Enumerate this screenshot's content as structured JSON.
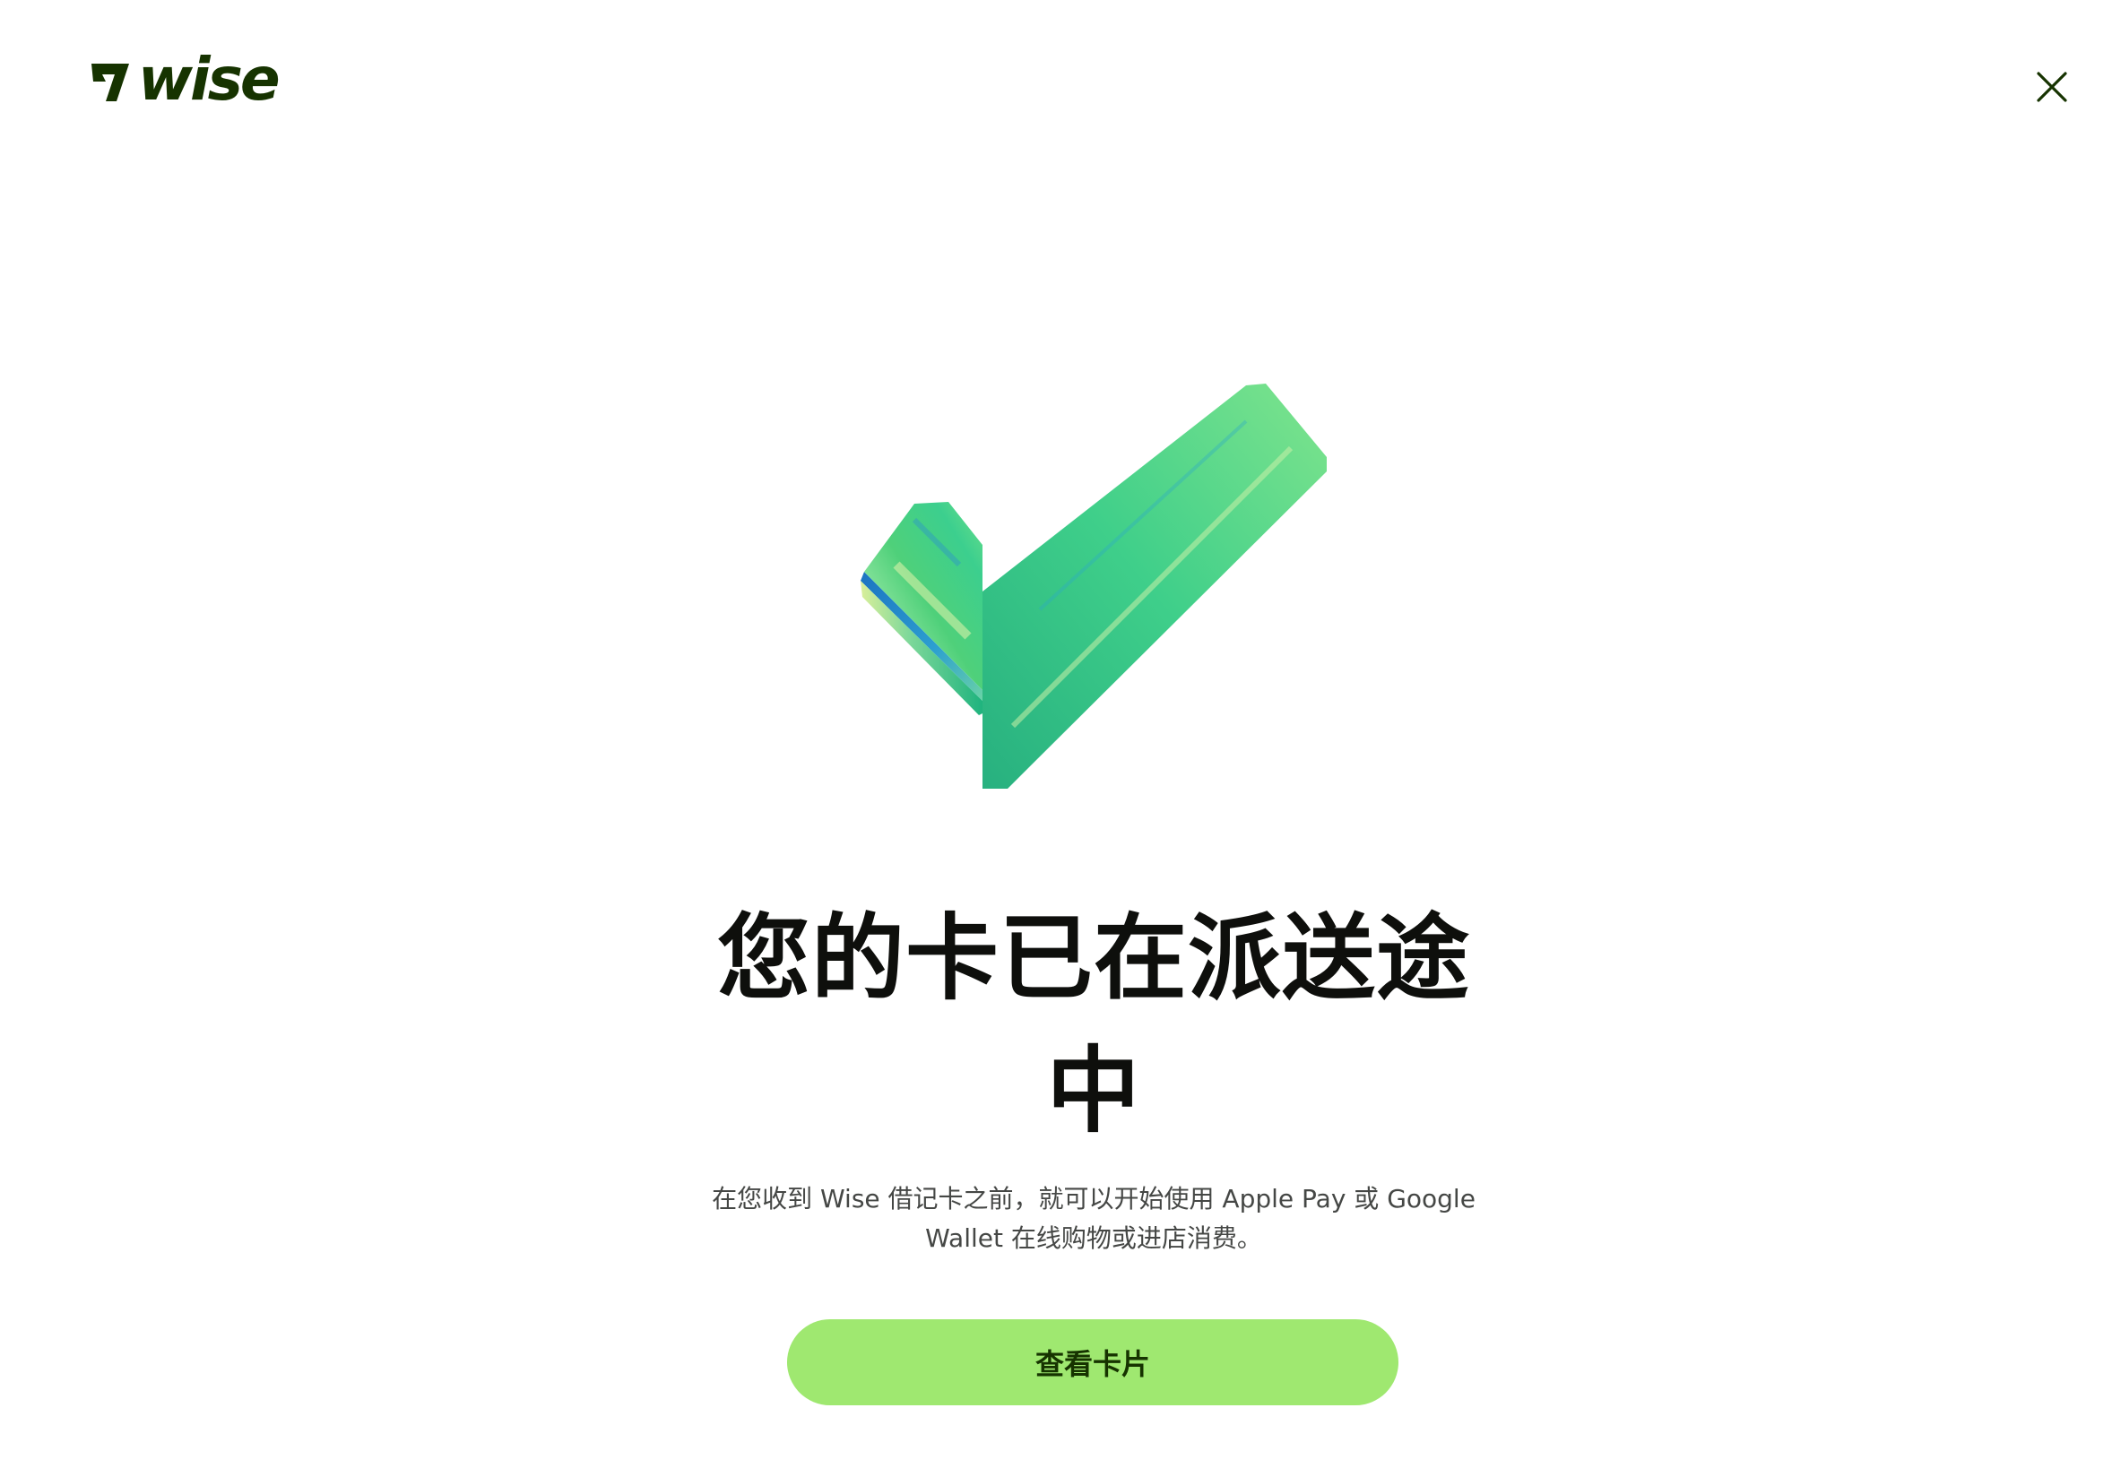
{
  "brand": {
    "logo_text": "wise",
    "color": "#163300"
  },
  "header": {
    "close_icon": "close-icon"
  },
  "hero": {
    "icon": "checkmark-illustration"
  },
  "main": {
    "title": "您的卡已在派送途中",
    "description": "在您收到 Wise 借记卡之前，就可以开始使用 Apple Pay 或 Google Wallet 在线购物或进店消费。",
    "cta_label": "查看卡片"
  },
  "colors": {
    "accent": "#9fe870",
    "accent_text": "#163300",
    "title": "#0e0f0c",
    "body_text": "#454745"
  }
}
